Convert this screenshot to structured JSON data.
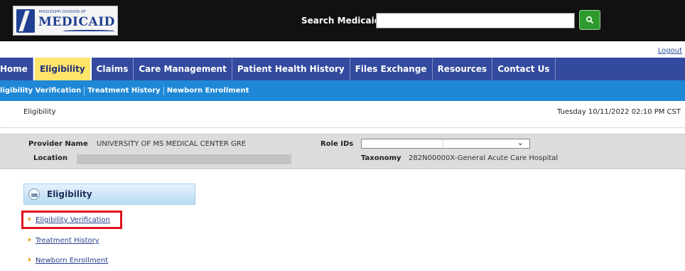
{
  "header": {
    "logo_small": "MISSISSIPPI DIVISION OF",
    "logo_big": "MEDICAID",
    "search_label": "Search Medicaid:",
    "search_value": ""
  },
  "logout_label": "Logout",
  "mainnav": {
    "items": [
      {
        "label": "Home"
      },
      {
        "label": "Eligibility"
      },
      {
        "label": "Claims"
      },
      {
        "label": "Care Management"
      },
      {
        "label": "Patient Health History"
      },
      {
        "label": "Files Exchange"
      },
      {
        "label": "Resources"
      },
      {
        "label": "Contact Us"
      }
    ]
  },
  "subnav": {
    "items": [
      {
        "label": "ligibility Verification"
      },
      {
        "label": "Treatment History"
      },
      {
        "label": "Newborn Enrollment"
      }
    ]
  },
  "breadcrumb": {
    "title": "Eligibility",
    "datetime": "Tuesday 10/11/2022 02:10 PM CST"
  },
  "provider": {
    "name_label": "Provider Name",
    "name_value": "UNIVERSITY OF MS MEDICAL CENTER GRE",
    "location_label": "Location",
    "role_label": "Role IDs",
    "taxonomy_label": "Taxonomy",
    "taxonomy_value": "282N00000X-General Acute Care Hospital"
  },
  "panel": {
    "title": "Eligibility",
    "links": [
      {
        "label": "Eligibility Verification"
      },
      {
        "label": "Treatment History"
      },
      {
        "label": "Newborn Enrollment"
      }
    ]
  },
  "colors": {
    "nav_bg": "#334a9e",
    "nav_active": "#ffe46a",
    "subnav_bg": "#1e88d6",
    "highlight": "#e0141e",
    "search_button": "#2e9a2e"
  }
}
